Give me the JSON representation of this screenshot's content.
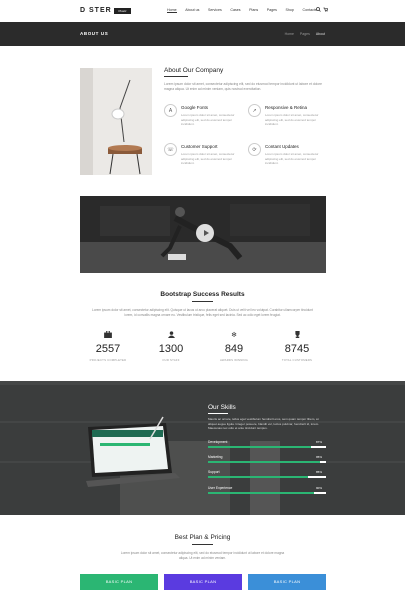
{
  "nav": {
    "logo": "D  STER",
    "logo_badge": "Pixelz",
    "menu": [
      "Home",
      "About us",
      "Services",
      "Cases",
      "Plans",
      "Pages",
      "Shop",
      "Contacts"
    ]
  },
  "hero": {
    "title": "ABOUT US",
    "crumbs": [
      "Home",
      "Pages",
      "About"
    ]
  },
  "about": {
    "title": "About Our Company",
    "desc": "Lorem ipsum dolor sit amet, consectetur adipiscing elit, sed do eiusmod tempor incididunt ut labore et dolore magna aliqua. Ut enim ad minim veniam, quis nostrud exercitation.",
    "features": [
      {
        "title": "Google Fonts",
        "desc": "Lorem ipsum dolor sit amet, consectetur adipiscing elit, sed do eiusmod tempor incididunt.",
        "icon": "text-icon"
      },
      {
        "title": "Responsive & Retina",
        "desc": "Lorem ipsum dolor sit amet, consectetur adipiscing elit, sed do eiusmod tempor incididunt.",
        "icon": "pointer-icon"
      },
      {
        "title": "Customer Support",
        "desc": "Lorem ipsum dolor sit amet, consectetur adipiscing elit, sed do eiusmod tempor incididunt.",
        "icon": "phone-icon"
      },
      {
        "title": "Contant Updates",
        "desc": "Lorem ipsum dolor sit amet, consectetur adipiscing elit, sed do eiusmod tempor incididunt.",
        "icon": "refresh-icon"
      }
    ]
  },
  "success": {
    "title": "Bootstrap Success Results",
    "desc": "Lorem ipsum dolor sit amet, consectetur adipiscing elit. Quisque ut lacus ut arcu placerat aliquet. Duis ut velit vel leo volutpat. Curabitur ullamcorper tincidunt lorem, id convallis magna ornare eu. Vestibulum tristique, felis eget sed lacinia. Sed ac odio eget lorem feugiat.",
    "stats": [
      {
        "num": "2557",
        "label": "PROJECTS COMPLETED",
        "icon": "briefcase-icon"
      },
      {
        "num": "1300",
        "label": "OUR STAFF",
        "icon": "user-icon"
      },
      {
        "num": "849",
        "label": "AWARDS WINNING",
        "icon": "snowflake-icon"
      },
      {
        "num": "8745",
        "label": "TOTAL CUSTOMERS",
        "icon": "trophy-icon"
      }
    ]
  },
  "skills": {
    "title": "Our Skills",
    "desc": "Mauris ac ornare, tellus eget vestibulum hendrerit eros, sem quam tempor libero, at aliquet augue ligula. Integer posuere, blandit vel, luctus pulvinar, hendrerit id, lorem. Maecenas nec odio et ante tincidunt tempus.",
    "items": [
      {
        "label": "Development",
        "pct": "87%",
        "value": 0.87
      },
      {
        "label": "Marketing",
        "pct": "95%",
        "value": 0.95
      },
      {
        "label": "Support",
        "pct": "85%",
        "value": 0.85
      },
      {
        "label": "User Experience",
        "pct": "90%",
        "value": 0.9
      }
    ]
  },
  "pricing": {
    "title": "Best Plan & Pricing",
    "desc": "Lorem ipsum dolor sit amet, consectetur adipiscing elit, sed do eiusmod tempor incididunt ut labore et dolore magna aliqua. Ut enim ad minim veniam.",
    "plans": [
      {
        "label": "BASIC PLAN",
        "color": "#2bb673"
      },
      {
        "label": "BASIC PLAN",
        "color": "#5a3be0"
      },
      {
        "label": "BASIC PLAN",
        "color": "#3b8fd8"
      }
    ]
  }
}
